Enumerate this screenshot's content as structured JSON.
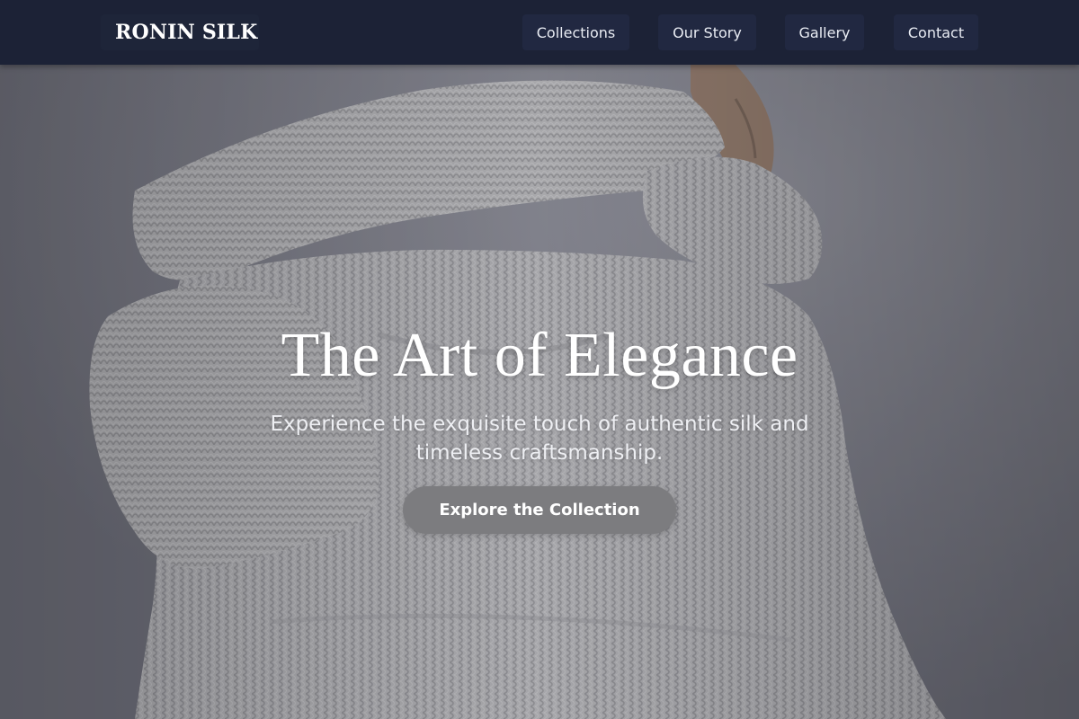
{
  "header": {
    "logo": "RONIN SILK",
    "nav": [
      {
        "label": "Collections"
      },
      {
        "label": "Our Story"
      },
      {
        "label": "Gallery"
      },
      {
        "label": "Contact"
      }
    ]
  },
  "hero": {
    "title": "The Art of Elegance",
    "subtitle": "Experience the exquisite touch of authentic silk and timeless craftsmanship.",
    "cta_label": "Explore the Collection",
    "image_subject": "person-in-chunky-knit-sweater"
  },
  "colors": {
    "header_bg": "#1c2236",
    "nav_item_bg": "#212841",
    "cta_bg": "#7c7c7f",
    "text_light": "#ffffff"
  }
}
